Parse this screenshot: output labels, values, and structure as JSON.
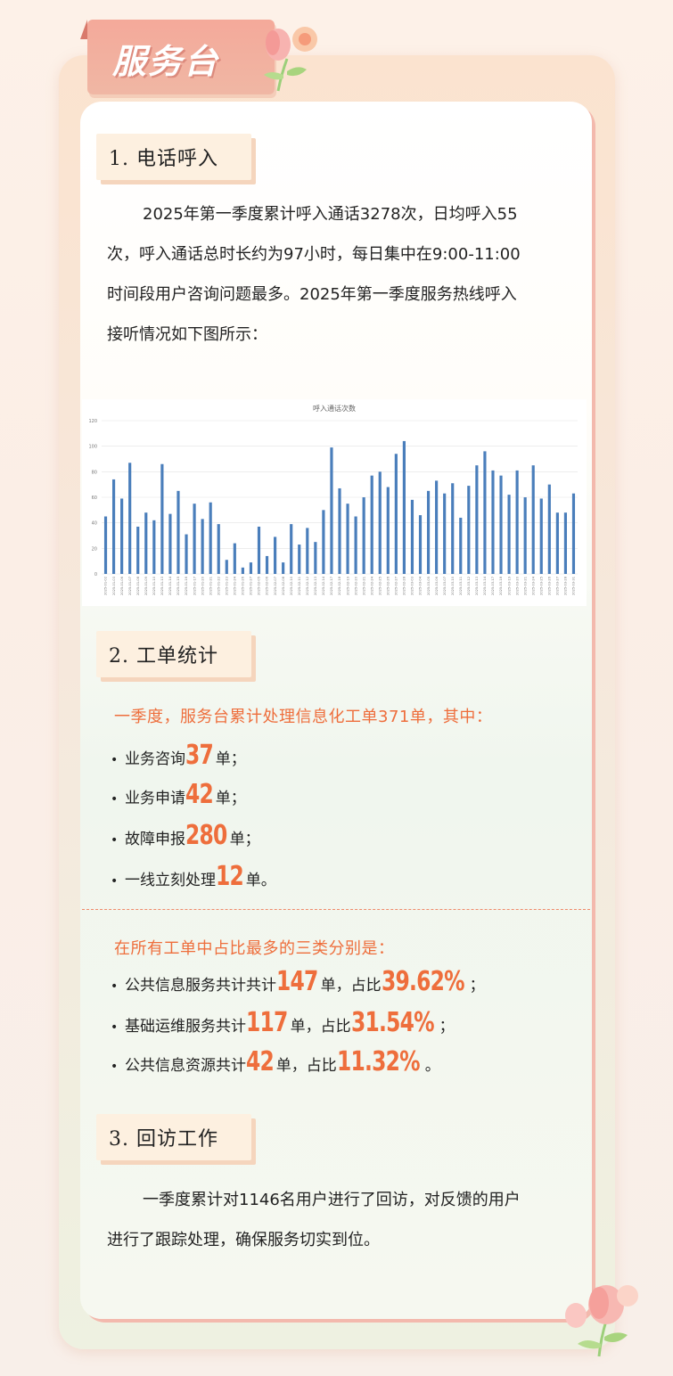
{
  "header": {
    "title": "服务台"
  },
  "sections": {
    "phone": {
      "heading": "1. 电话呼入",
      "lines": [
        "2025年第一季度累计呼入通话3278次，日均呼入55",
        "次，呼入通话总时长约为97小时，每日集中在9:00-11:00",
        "时间段用户咨询问题最多。2025年第一季度服务热线呼入",
        "接听情况如下图所示："
      ]
    },
    "tickets": {
      "heading": "2. 工单统计",
      "summary": "一季度，服务台累计处理信息化工单371单，其中：",
      "items": [
        {
          "label": "业务咨询",
          "value": "37",
          "unit": "单；"
        },
        {
          "label": "业务申请",
          "value": "42",
          "unit": "单；"
        },
        {
          "label": "故障申报",
          "value": "280",
          "unit": "单；"
        },
        {
          "label": "一线立刻处理",
          "value": "12",
          "unit": "单。"
        }
      ],
      "top_heading": "在所有工单中占比最多的三类分别是：",
      "top_items": [
        {
          "label": "公共信息服务共计共计",
          "value": "147",
          "mid": "单，占比",
          "pct": "39.62%",
          "end": "；"
        },
        {
          "label": "基础运维服务共计",
          "value": "117",
          "mid": "单，占比",
          "pct": "31.54%",
          "end": "；"
        },
        {
          "label": "公共信息资源共计",
          "value": "42",
          "mid": "单，占比",
          "pct": "11.32%",
          "end": "。"
        }
      ]
    },
    "followup": {
      "heading": "3. 回访工作",
      "lines": [
        "一季度累计对1146名用户进行了回访，对反馈的用户",
        "进行了跟踪处理，确保服务切实到位。"
      ]
    }
  },
  "chart_data": {
    "type": "bar",
    "title": "呼入通话次数",
    "ylim": [
      0,
      120
    ],
    "yticks": [
      0,
      20,
      40,
      60,
      80,
      100,
      120
    ],
    "grid": true,
    "bar_color": "#4a7ebb",
    "categories": [
      "2025-01-02",
      "2025-01-03",
      "2025-01-06",
      "2025-01-07",
      "2025-01-08",
      "2025-01-09",
      "2025-01-10",
      "2025-01-13",
      "2025-01-14",
      "2025-01-15",
      "2025-01-16",
      "2025-01-17",
      "2025-01-20",
      "2025-01-21",
      "2025-01-22",
      "2025-01-23",
      "2025-01-24",
      "2025-01-26",
      "2025-01-27",
      "2025-02-05",
      "2025-02-06",
      "2025-02-07",
      "2025-02-08",
      "2025-02-10",
      "2025-02-11",
      "2025-02-12",
      "2025-02-13",
      "2025-02-14",
      "2025-02-17",
      "2025-02-18",
      "2025-02-19",
      "2025-02-20",
      "2025-02-21",
      "2025-02-24",
      "2025-02-25",
      "2025-02-26",
      "2025-02-27",
      "2025-02-28",
      "2025-03-03",
      "2025-03-04",
      "2025-03-05",
      "2025-03-06",
      "2025-03-07",
      "2025-03-10",
      "2025-03-11",
      "2025-03-12",
      "2025-03-13",
      "2025-03-14",
      "2025-03-17",
      "2025-03-18",
      "2025-03-19",
      "2025-03-20",
      "2025-03-21",
      "2025-03-24",
      "2025-03-25",
      "2025-03-26",
      "2025-03-27",
      "2025-03-28",
      "2025-03-31"
    ],
    "values": [
      45,
      74,
      59,
      87,
      37,
      48,
      42,
      86,
      47,
      65,
      31,
      55,
      43,
      56,
      39,
      11,
      24,
      5,
      9,
      37,
      14,
      29,
      9,
      39,
      23,
      36,
      25,
      50,
      99,
      67,
      55,
      45,
      60,
      77,
      80,
      68,
      94,
      104,
      58,
      46,
      65,
      73,
      63,
      71,
      44,
      69,
      85,
      96,
      81,
      77,
      62,
      81,
      60,
      85,
      59,
      70,
      48,
      48,
      63
    ]
  }
}
